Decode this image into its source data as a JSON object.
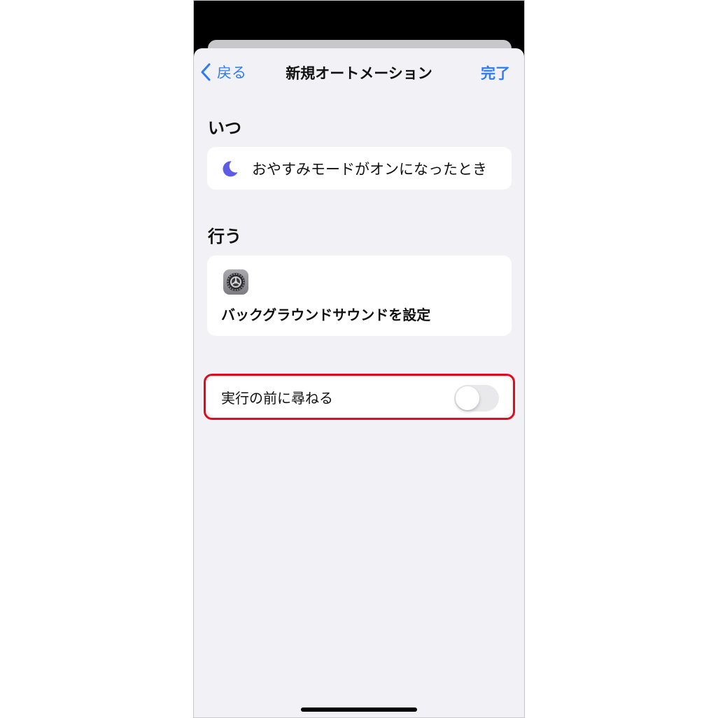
{
  "nav": {
    "back_label": "戻る",
    "title": "新規オートメーション",
    "done_label": "完了"
  },
  "when": {
    "section_title": "いつ",
    "trigger_text": "おやすみモードがオンになったとき",
    "trigger_icon": "moon-icon"
  },
  "do": {
    "section_title": "行う",
    "action_text": "バックグラウンドサウンドを設定",
    "action_icon": "settings-app-icon"
  },
  "ask_before_running": {
    "label": "実行の前に尋ねる",
    "enabled": false
  },
  "colors": {
    "accent": "#2f7bf5",
    "moon": "#5e5ce6",
    "highlight": "#e00c1c",
    "sheet_background": "#f1f1f6"
  }
}
